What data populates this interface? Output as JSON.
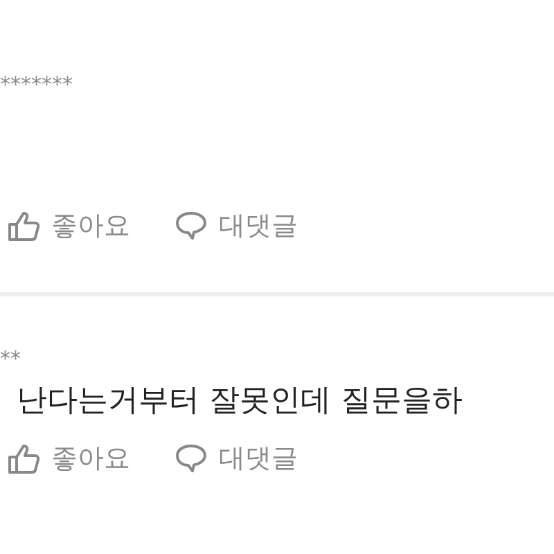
{
  "comments": [
    {
      "author": "*******",
      "actions": [
        {
          "kind": "like",
          "label": "좋아요"
        },
        {
          "kind": "reply",
          "label": "대댓글"
        }
      ]
    },
    {
      "author": "**",
      "text": "난다는거부터 잘못인데 질문을하",
      "actions": [
        {
          "kind": "like",
          "label": "좋아요"
        },
        {
          "kind": "reply",
          "label": "대댓글"
        }
      ]
    }
  ]
}
